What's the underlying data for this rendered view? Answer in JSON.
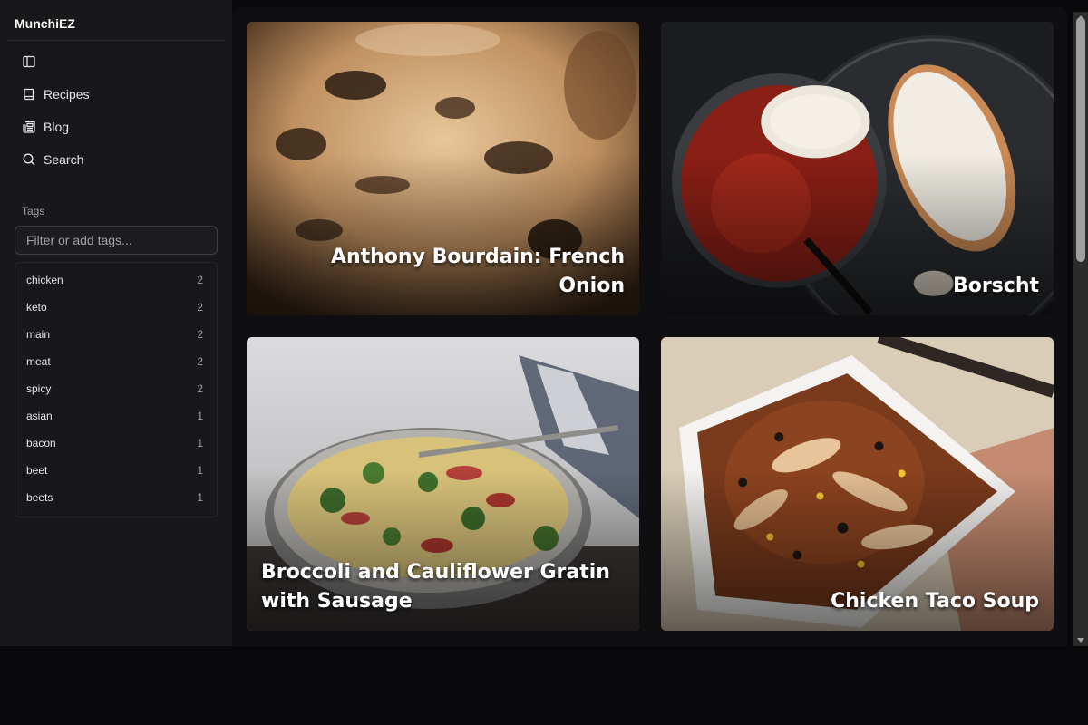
{
  "app": {
    "name": "MunchiEZ"
  },
  "nav": {
    "toggle_icon": "sidebar-panel-icon",
    "items": [
      {
        "label": "Recipes",
        "icon": "book-icon"
      },
      {
        "label": "Blog",
        "icon": "newspaper-icon"
      },
      {
        "label": "Search",
        "icon": "search-icon"
      }
    ]
  },
  "tags": {
    "heading": "Tags",
    "placeholder": "Filter or add tags...",
    "items": [
      {
        "name": "chicken",
        "count": "2"
      },
      {
        "name": "keto",
        "count": "2"
      },
      {
        "name": "main",
        "count": "2"
      },
      {
        "name": "meat",
        "count": "2"
      },
      {
        "name": "spicy",
        "count": "2"
      },
      {
        "name": "asian",
        "count": "1"
      },
      {
        "name": "bacon",
        "count": "1"
      },
      {
        "name": "beet",
        "count": "1"
      },
      {
        "name": "beets",
        "count": "1"
      }
    ]
  },
  "recipes": [
    {
      "title": "Anthony Bourdain: French Onion",
      "align": "right"
    },
    {
      "title": "Borscht",
      "align": "right"
    },
    {
      "title": "Broccoli and Cauliflower Gratin with Sausage",
      "align": "left"
    },
    {
      "title": "Chicken Taco Soup",
      "align": "right"
    }
  ],
  "colors": {
    "sidebar_bg": "#18181b",
    "page_bg": "#09090b",
    "content_bg": "#0f0f11",
    "text": "#e4e4e7",
    "muted": "#a1a1aa",
    "border": "#27272a"
  }
}
